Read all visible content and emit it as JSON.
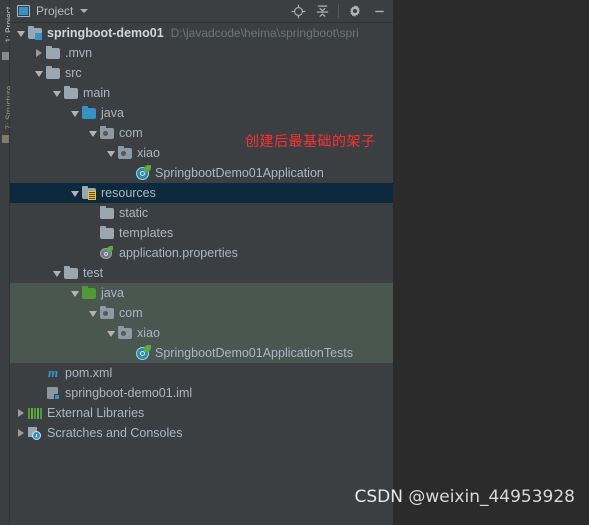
{
  "toolwindow": {
    "title": "Project",
    "project_icon": "project-icon",
    "dropdown_icon": "chevron-down-icon",
    "actions": [
      {
        "name": "locate-icon",
        "label": "Select Opened File"
      },
      {
        "name": "collapse-all-icon",
        "label": "Collapse All"
      },
      {
        "name": "gear-icon",
        "label": "Settings"
      },
      {
        "name": "minimize-icon",
        "label": "Hide"
      }
    ]
  },
  "side_tabs": [
    {
      "label": "1: Project"
    },
    {
      "label": "7: Structure"
    }
  ],
  "tree": [
    {
      "indent": 0,
      "arrow": "open",
      "icon": "module-folder",
      "label": "springboot-demo01",
      "sub": "D:\\javadcode\\heima\\springboot\\spri",
      "bold": true
    },
    {
      "indent": 1,
      "arrow": "closed",
      "icon": "folder-grey",
      "label": ".mvn"
    },
    {
      "indent": 1,
      "arrow": "open",
      "icon": "folder-grey",
      "label": "src"
    },
    {
      "indent": 2,
      "arrow": "open",
      "icon": "folder-grey",
      "label": "main"
    },
    {
      "indent": 3,
      "arrow": "open",
      "icon": "folder-blue",
      "label": "java"
    },
    {
      "indent": 4,
      "arrow": "open",
      "icon": "package",
      "label": "com"
    },
    {
      "indent": 5,
      "arrow": "open",
      "icon": "package",
      "label": "xiao"
    },
    {
      "indent": 6,
      "arrow": "none",
      "icon": "spring-class",
      "label": "SpringbootDemo01Application"
    },
    {
      "indent": 3,
      "arrow": "open",
      "icon": "folder-resources",
      "label": "resources",
      "selected": true
    },
    {
      "indent": 4,
      "arrow": "none",
      "icon": "folder-grey",
      "label": "static"
    },
    {
      "indent": 4,
      "arrow": "none",
      "icon": "folder-grey",
      "label": "templates"
    },
    {
      "indent": 4,
      "arrow": "none",
      "icon": "spring-properties",
      "label": "application.properties"
    },
    {
      "indent": 2,
      "arrow": "open",
      "icon": "folder-grey",
      "label": "test"
    },
    {
      "indent": 3,
      "arrow": "open",
      "icon": "folder-green",
      "label": "java",
      "testsrc": true
    },
    {
      "indent": 4,
      "arrow": "open",
      "icon": "package",
      "label": "com",
      "testsrc": true
    },
    {
      "indent": 5,
      "arrow": "open",
      "icon": "package",
      "label": "xiao",
      "testsrc": true
    },
    {
      "indent": 6,
      "arrow": "none",
      "icon": "spring-class",
      "label": "SpringbootDemo01ApplicationTests",
      "testsrc": true
    },
    {
      "indent": 1,
      "arrow": "none",
      "icon": "maven",
      "label": "pom.xml"
    },
    {
      "indent": 1,
      "arrow": "none",
      "icon": "iml",
      "label": "springboot-demo01.iml"
    },
    {
      "indent": 0,
      "arrow": "closed",
      "icon": "libraries",
      "label": "External Libraries"
    },
    {
      "indent": 0,
      "arrow": "closed",
      "icon": "scratches",
      "label": "Scratches and Consoles"
    }
  ],
  "annotation": {
    "text": "创建后最基础的架子",
    "color": "#ff2f2f"
  },
  "watermark": {
    "prefix": "CSDN",
    "handle": "@weixin_44953928"
  },
  "colors": {
    "panel_bg": "#3c3f41",
    "editor_bg": "#2b2b2b",
    "selection": "#0d293e",
    "test_source": "#4a5650",
    "text": "#a9b7c6",
    "muted": "#6e7679"
  }
}
